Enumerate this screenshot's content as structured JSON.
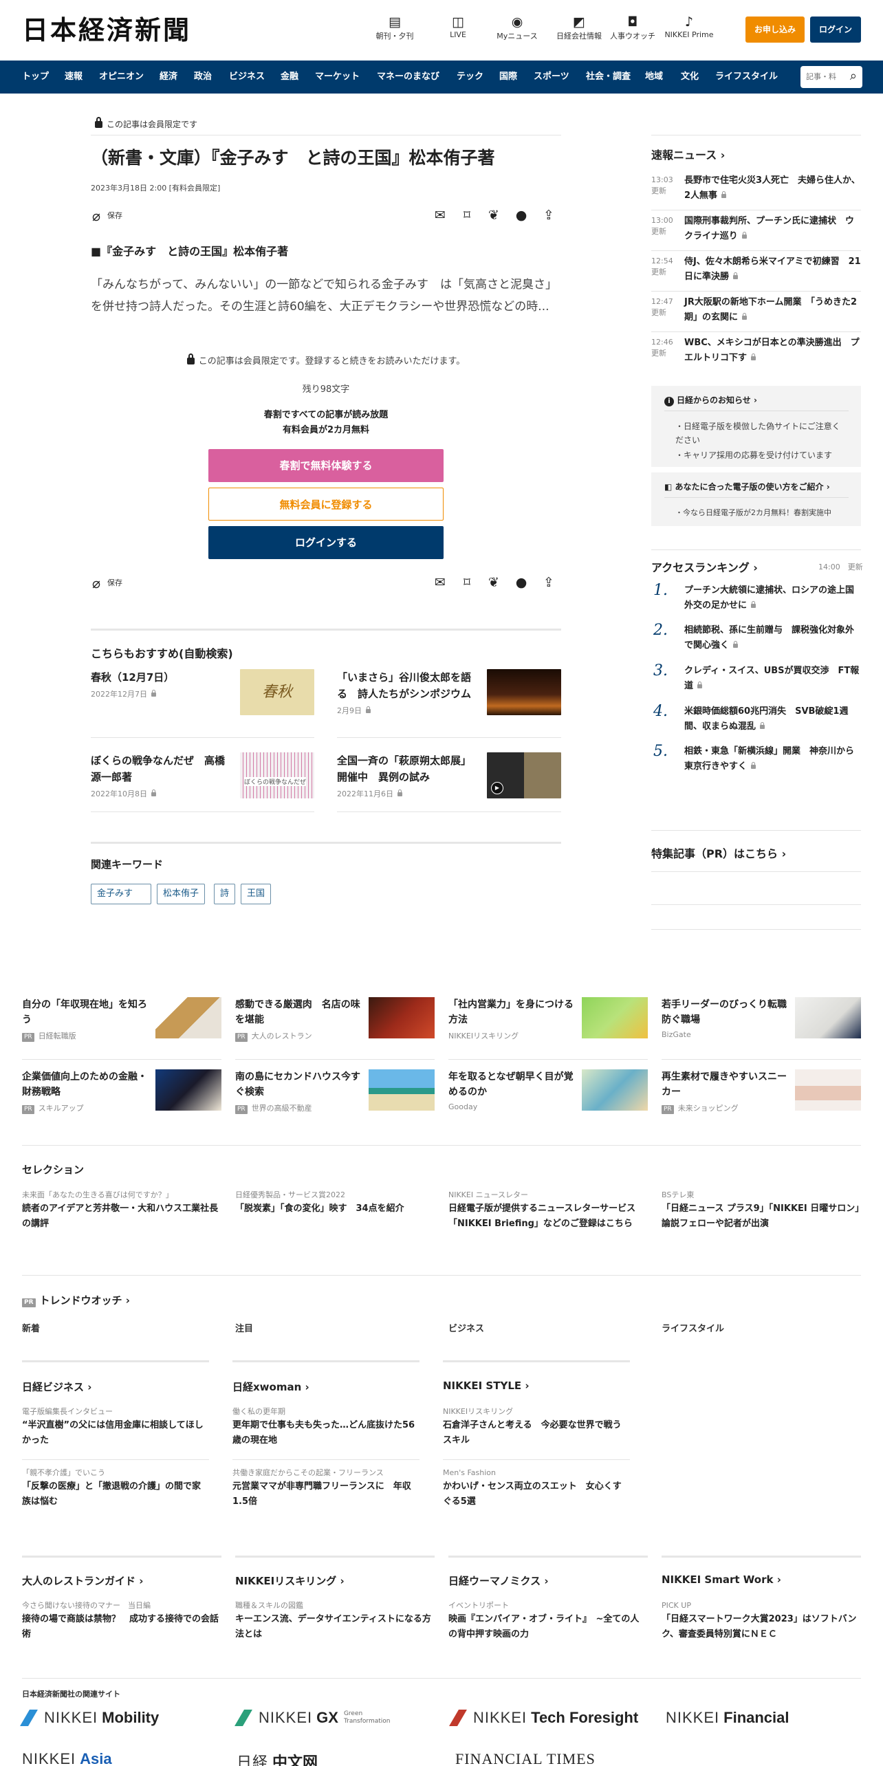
{
  "header": {
    "logo": "日本経済新聞",
    "icons": [
      {
        "label": "朝刊・夕刊",
        "icon": "newspaper-icon",
        "glyph": "▤"
      },
      {
        "label": "LIVE",
        "icon": "video-icon",
        "glyph": "◫"
      },
      {
        "label": "Myニュース",
        "icon": "user-icon",
        "glyph": "◉"
      },
      {
        "label": "日経会社情報",
        "icon": "chart-icon",
        "glyph": "◩"
      },
      {
        "label": "人事ウオッチ",
        "icon": "search-icon",
        "glyph": "◘"
      },
      {
        "label": "NIKKEI Prime",
        "icon": "prime-icon",
        "glyph": "♪"
      }
    ],
    "apply": "お申し込み",
    "login": "ログイン"
  },
  "nav": {
    "items": [
      "トップ",
      "速報",
      "オピニオン",
      "経済",
      "政治",
      "ビジネス",
      "金融",
      "マーケット",
      "マネーのまなび",
      "テック",
      "国際",
      "スポーツ",
      "社会・調査",
      "地域",
      "文化",
      "ライフスタイル"
    ],
    "search_placeholder": "記事・料"
  },
  "article": {
    "members_only": "この記事は会員限定です",
    "title": "（新書・文庫）『金子みす　と詩の王国』松本侑子著",
    "date": "2023年3月18日 2:00 [有料会員限定]",
    "save": "保存",
    "subhead": "■『金子みす　と詩の王国』松本侑子著",
    "body": "「みんなちがって、みんないい」の一節などで知られる金子みす　は「気高さと泥臭さ」を併せ持つ詩人だった。その生涯と詩60編を、大正デモクラシーや世界恐慌などの時...",
    "lock_note": "この記事は会員限定です。登録すると続きをお読みいただけます。",
    "remaining": "残り98文字",
    "promo1": "春割ですべての記事が読み放題",
    "promo2": "有料会員が2カ月無料",
    "btn_trial": "春割で無料体験する",
    "btn_register": "無料会員に登録する",
    "btn_login": "ログインする"
  },
  "recommend": {
    "heading": "こちらもおすすめ(自動検索)",
    "items": [
      {
        "title": "春秋（12月7日）",
        "date": "2022年12月7日",
        "thumb": "春秋"
      },
      {
        "title": "「いまさら」谷川俊太郎を語る　詩人たちがシンポジウム",
        "date": "2月9日"
      },
      {
        "title": "ぼくらの戦争なんだぜ　高橋源一郎著",
        "date": "2022年10月8日",
        "thumb": "ぼくらの戦争なんだぜ"
      },
      {
        "title": "全国一斉の「萩原朔太郎展」開催中　異例の試み",
        "date": "2022年11月6日"
      }
    ]
  },
  "keywords": {
    "heading": "関連キーワード",
    "items": [
      "金子みす",
      "松本侑子",
      "詩",
      "王国"
    ]
  },
  "sidebar": {
    "breaking_heading": "速報ニュース",
    "updated": "更新",
    "breaking": [
      {
        "time": "13:03",
        "title": "長野市で住宅火災3人死亡　夫婦ら住人か、2人無事"
      },
      {
        "time": "13:00",
        "title": "国際刑事裁判所、プーチン氏に逮捕状　ウクライナ巡り"
      },
      {
        "time": "12:54",
        "title": "侍J、佐々木朗希ら米マイアミで初練習　21日に準決勝"
      },
      {
        "time": "12:47",
        "title": "JR大阪駅の新地下ホーム開業　「うめきた2期」の玄関に"
      },
      {
        "time": "12:46",
        "title": "WBC、メキシコが日本との準決勝進出　プエルトリコ下す"
      }
    ],
    "notice_heading": "日経からのお知らせ",
    "notices": [
      "日経電子版を模倣した偽サイトにご注意ください",
      "キャリア採用の応募を受け付けています"
    ],
    "guide_heading": "あなたに合った電子版の使い方をご紹介",
    "guide_items": [
      "今なら日経電子版が2カ月無料！春割実施中"
    ],
    "ranking_heading": "アクセスランキング",
    "ranking_time": "14:00",
    "ranking_updated": "更新",
    "ranking": [
      {
        "n": "1.",
        "title": "プーチン大統領に逮捕状、ロシアの途上国外交の足かせに"
      },
      {
        "n": "2.",
        "title": "相続節税、孫に生前贈与　課税強化対象外で関心強く"
      },
      {
        "n": "3.",
        "title": "クレディ・スイス、UBSが買収交渉　FT報道"
      },
      {
        "n": "4.",
        "title": "米銀時価総額60兆円消失　SVB破綻1週間、収まらぬ混乱"
      },
      {
        "n": "5.",
        "title": "相鉄・東急「新横浜線」開業　神奈川から東京行きやすく"
      }
    ],
    "pr_heading": "特集記事（PR）はこちら"
  },
  "ads": [
    {
      "title": "自分の「年収現在地」を知ろう",
      "src": "日経転職版",
      "pr": true
    },
    {
      "title": "感動できる厳選肉　名店の味を堪能",
      "src": "大人のレストラン",
      "pr": true
    },
    {
      "title": "「社内営業力」を身につける方法",
      "src": "NIKKEIリスキリング",
      "pr": false
    },
    {
      "title": "若手リーダーのびっくり転職防ぐ職場",
      "src": "BizGate",
      "pr": false
    },
    {
      "title": "企業価値向上のための金融・財務戦略",
      "src": "スキルアップ",
      "pr": true
    },
    {
      "title": "南の島にセカンドハウス今すぐ検索",
      "src": "世界の高級不動産",
      "pr": true
    },
    {
      "title": "年を取るとなぜ朝早く目が覚めるのか",
      "src": "Gooday",
      "pr": false
    },
    {
      "title": "再生素材で履きやすいスニーカー",
      "src": "未来ショッピング",
      "pr": true
    }
  ],
  "pr_label": "PR",
  "selection": {
    "heading": "セレクション",
    "items": [
      {
        "cap": "未来面「あなたの生きる喜びは何ですか？」",
        "title": "読者のアイデアと芳井敬一・大和ハウス工業社長の講評"
      },
      {
        "cap": "日経優秀製品・サービス賞2022",
        "title": "「脱炭素」「食の変化」映す　34点を紹介"
      },
      {
        "cap": "NIKKEI ニュースレター",
        "title": "日経電子版が提供するニュースレターサービス「NIKKEI Briefing」などのご登録はこちら"
      },
      {
        "cap": "BSテレ東",
        "title": "「日経ニュース プラス9」「NIKKEI 日曜サロン」論説フェローや記者が出演"
      }
    ]
  },
  "trend": {
    "heading": "トレンドウオッチ",
    "tabs": [
      "新着",
      "注目",
      "ビジネス",
      "ライフスタイル"
    ]
  },
  "media": [
    {
      "heading": "日経ビジネス",
      "items": [
        {
          "cap": "電子版編集長インタビュー",
          "title": "“半沢直樹”の父には信用金庫に相談してほしかった"
        },
        {
          "cap": "「親不孝介護」でいこう",
          "title": "「反撃の医療」と「撤退戦の介護」の間で家族は悩む"
        }
      ]
    },
    {
      "heading": "日経xwoman",
      "items": [
        {
          "cap": "働く私の更年期",
          "title": "更年期で仕事も夫も失った…どん底抜けた56歳の現在地"
        },
        {
          "cap": "共働き家庭だからこその起業・フリーランス",
          "title": "元営業ママが非専門職フリーランスに　年収1.5倍"
        }
      ]
    },
    {
      "heading": "NIKKEI STYLE",
      "items": [
        {
          "cap": "NIKKEIリスキリング",
          "title": "石倉洋子さんと考える　今必要な世界で戦うスキル"
        },
        {
          "cap": "Men's Fashion",
          "title": "かわいげ・センス両立のスエット　女心くすぐる5選"
        }
      ]
    }
  ],
  "media2": [
    {
      "heading": "大人のレストランガイド",
      "cap": "今さら聞けない接待のマナー　当日編",
      "title": "接待の場で商談は禁物？　成功する接待での会話術"
    },
    {
      "heading": "NIKKEIリスキリング",
      "cap": "職種＆スキルの図鑑",
      "title": "キーエンス流、データサイエンティストになる方法とは"
    },
    {
      "heading": "日経ウーマノミクス",
      "cap": "イベントリポート",
      "title": "映画『エンパイア・オブ・ライト』　~全ての人の背中押す映画の力"
    },
    {
      "heading": "NIKKEI Smart Work",
      "cap": "PICK UP",
      "title": "「日経スマートワーク大賞2023」はソフトバンク、審査委員特別賞にＮＥＣ"
    }
  ],
  "related": {
    "heading": "日本経済新聞社の関連サイト",
    "logos": [
      {
        "brand": "NIKKEI",
        "name": "Mobility",
        "color": "#2a8fd6"
      },
      {
        "brand": "NIKKEI",
        "name": "GX",
        "sub": "Green Transformation",
        "color": "#2aa07a"
      },
      {
        "brand": "NIKKEI",
        "name": "Tech Foresight",
        "color": "#c0392b"
      },
      {
        "brand": "NIKKEI",
        "name": "Financial",
        "color": "#222222"
      },
      {
        "brand": "NIKKEI",
        "name": "Asia",
        "color": "#1a5fb4"
      },
      {
        "brand": "日経",
        "name": "中文网",
        "color": "#222222"
      },
      {
        "brand": "",
        "name": "FINANCIAL TIMES",
        "color": "#222222"
      }
    ]
  },
  "colors": {
    "nav": "#003a6c",
    "apply": "#f08c00",
    "trial": "#d9609e",
    "register": "#f08c00"
  }
}
